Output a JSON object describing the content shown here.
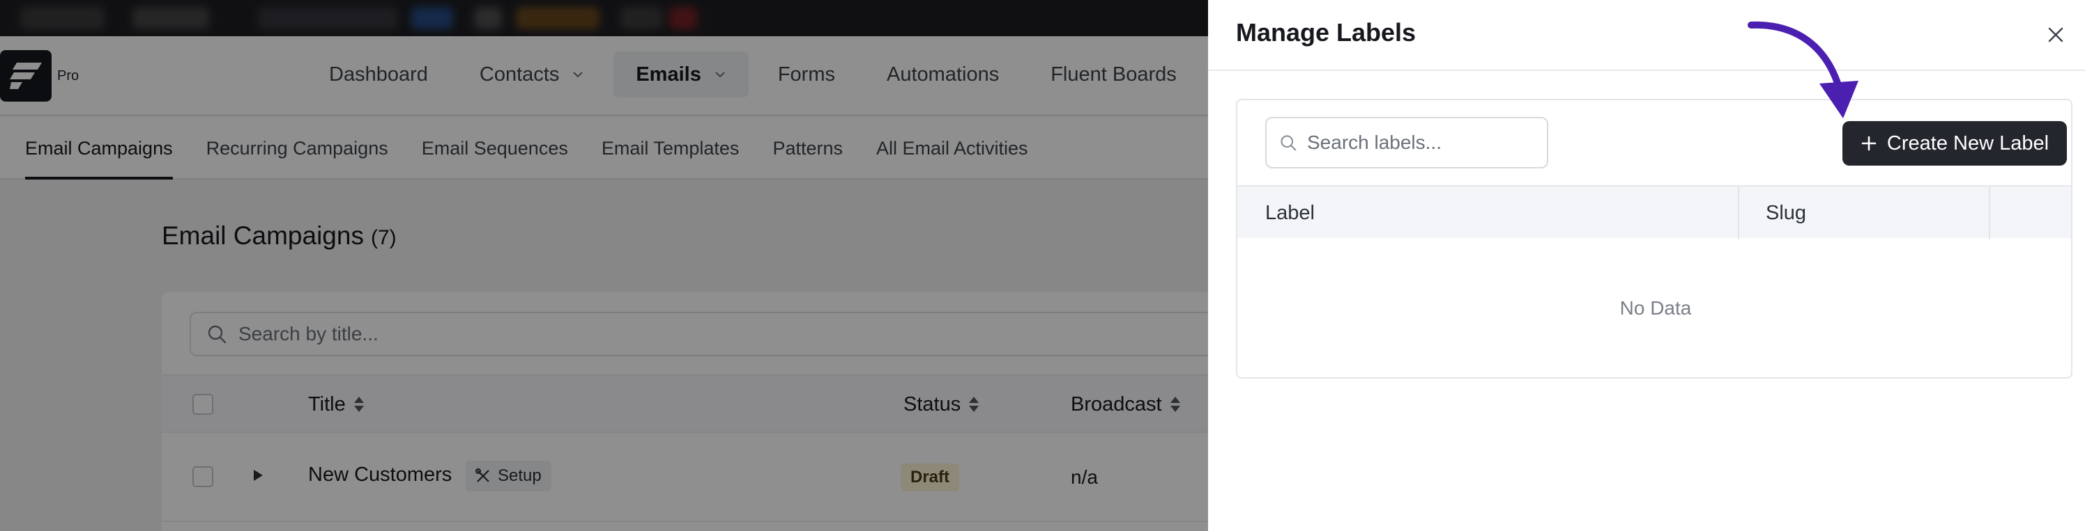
{
  "app": {
    "logo_badge": "Pro",
    "nav": [
      {
        "label": "Dashboard",
        "has_caret": false,
        "active": false
      },
      {
        "label": "Contacts",
        "has_caret": true,
        "active": false
      },
      {
        "label": "Emails",
        "has_caret": true,
        "active": true
      },
      {
        "label": "Forms",
        "has_caret": false,
        "active": false
      },
      {
        "label": "Automations",
        "has_caret": false,
        "active": false
      },
      {
        "label": "Fluent Boards",
        "has_caret": false,
        "active": false
      }
    ],
    "subnav": [
      {
        "label": "Email Campaigns",
        "active": true
      },
      {
        "label": "Recurring Campaigns",
        "active": false
      },
      {
        "label": "Email Sequences",
        "active": false
      },
      {
        "label": "Email Templates",
        "active": false
      },
      {
        "label": "Patterns",
        "active": false
      },
      {
        "label": "All Email Activities",
        "active": false
      }
    ]
  },
  "campaigns": {
    "title": "Email Campaigns",
    "count": "(7)",
    "search_placeholder": "Search by title...",
    "columns": {
      "title": "Title",
      "status": "Status",
      "broadcast": "Broadcast"
    },
    "rows": [
      {
        "title": "New Customers",
        "tag": "Setup",
        "status": "Draft",
        "broadcast": "n/a"
      }
    ]
  },
  "drawer": {
    "title": "Manage Labels",
    "search_placeholder": "Search labels...",
    "create_button": "Create New Label",
    "columns": {
      "label": "Label",
      "slug": "Slug"
    },
    "empty_text": "No Data"
  },
  "colors": {
    "primary_button": "#23262d",
    "annotation_arrow": "#4b1fb0",
    "draft_badge_bg": "#fdf2d8"
  }
}
